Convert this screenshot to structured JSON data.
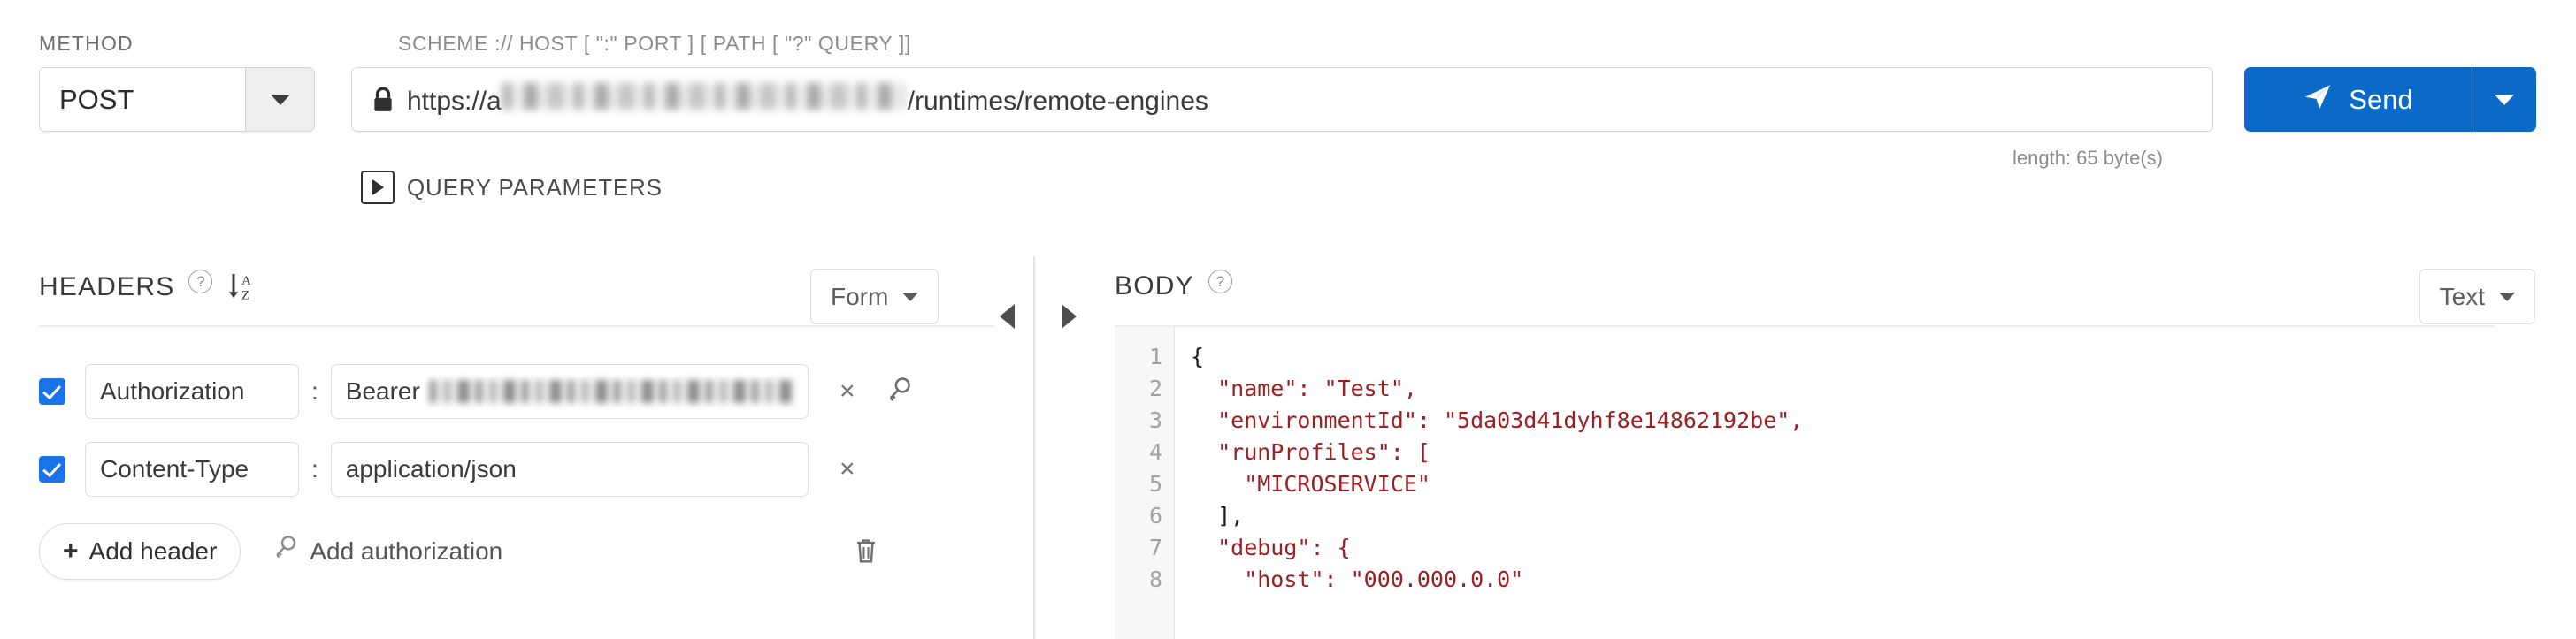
{
  "request_bar": {
    "method_label": "METHOD",
    "method_value": "POST",
    "method_caret_icon": "chevron-down-icon",
    "url_label": "SCHEME :// HOST [ \":\" PORT ] [ PATH [ \"?\" QUERY ]]",
    "url_lock_icon": "lock-icon",
    "url_prefix": "https://a",
    "url_redacted": true,
    "url_suffix": "/runtimes/remote-engines",
    "send_label": "Send",
    "send_icon": "paper-plane-icon",
    "send_caret_icon": "chevron-down-icon",
    "send_color": "#0b69c7",
    "length_note": "length: 65 byte(s)",
    "query_params_label": "QUERY PARAMETERS",
    "query_params_toggle_icon": "triangle-right-icon"
  },
  "headers_panel": {
    "title": "HEADERS",
    "help_icon": "question-mark-icon",
    "help_glyph": "?",
    "sort_icon": "sort-alpha-asc-icon",
    "sort_glyph_top": "A",
    "sort_glyph_bottom": "Z",
    "view_mode": "Form",
    "view_mode_caret_icon": "chevron-down-icon",
    "collapse_left_icon": "triangle-left-icon",
    "collapse_right_icon": "triangle-right-icon",
    "separator": ":",
    "rows": [
      {
        "enabled": true,
        "name": "Authorization",
        "value_prefix": "Bearer",
        "value_redacted": true,
        "delete_icon": "close-icon",
        "delete_glyph": "×",
        "key_icon": "key-icon",
        "has_key_action": true
      },
      {
        "enabled": true,
        "name": "Content-Type",
        "value_prefix": "application/json",
        "value_redacted": false,
        "delete_icon": "close-icon",
        "delete_glyph": "×",
        "key_icon": "key-icon",
        "has_key_action": false
      }
    ],
    "add_header_label": "Add header",
    "add_header_plus": "+",
    "add_authorization_label": "Add authorization",
    "add_authorization_icon": "key-icon",
    "delete_all_icon": "trash-icon"
  },
  "body_panel": {
    "title": "BODY",
    "help_icon": "question-mark-icon",
    "help_glyph": "?",
    "expand_icon": "triangle-right-icon",
    "format": "Text",
    "format_caret_icon": "chevron-down-icon",
    "line_numbers": [
      "1",
      "2",
      "3",
      "4",
      "5",
      "6",
      "7",
      "8"
    ],
    "code_lines": [
      "{",
      "  \"name\": \"Test\",",
      "  \"environmentId\": \"5da03d41dyhf8e14862192be\",",
      "  \"runProfiles\": [",
      "    \"MICROSERVICE\"",
      "  ],",
      "  \"debug\": {",
      "    \"host\": \"000.000.0.0\""
    ]
  }
}
